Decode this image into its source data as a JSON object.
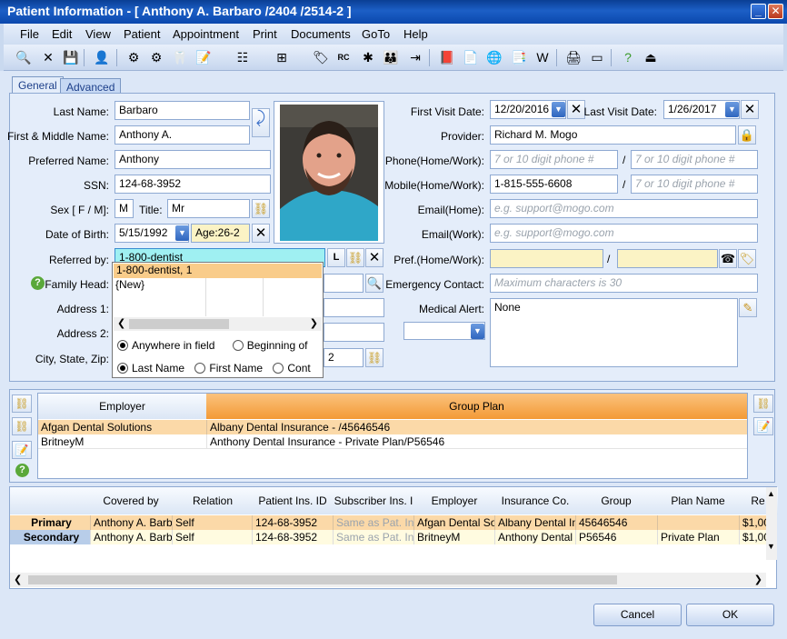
{
  "window": {
    "title": "Patient Information - [ Anthony A. Barbaro /2404 /2514-2 ]"
  },
  "menu": [
    "File",
    "Edit",
    "View",
    "Patient",
    "Appointment",
    "Print",
    "Documents",
    "GoTo",
    "Help"
  ],
  "tabs": [
    {
      "label": "General"
    },
    {
      "label": "Advanced"
    }
  ],
  "form": {
    "last_name_label": "Last Name:",
    "last_name": "Barbaro",
    "first_name_label": "First & Middle Name:",
    "first_name": "Anthony A.",
    "preferred_name_label": "Preferred Name:",
    "preferred_name": "Anthony",
    "ssn_label": "SSN:",
    "ssn": "124-68-3952",
    "sex_label": "Sex [ F / M]:",
    "sex": "M",
    "title_label": "Title:",
    "title": "Mr",
    "dob_label": "Date of Birth:",
    "dob": "5/15/1992",
    "age": "Age:26-2",
    "referred_label": "Referred by:",
    "referred_value": "1-800-dentist",
    "l_button": "L",
    "family_head_label": "Family Head:",
    "address1_label": "Address 1:",
    "address2_label": "Address 2:",
    "city_label": "City, State, Zip:",
    "city_partial": "2",
    "first_visit_label": "First Visit Date:",
    "first_visit": "12/20/2016",
    "last_visit_label": "Last Visit Date:",
    "last_visit": "1/26/2017",
    "provider_label": "Provider:",
    "provider": "Richard M. Mogo",
    "phone_label": "Phone(Home/Work):",
    "phone_ph": "7 or 10 digit phone #",
    "mobile_label": "Mobile(Home/Work):",
    "mobile": "1-815-555-6608",
    "email_home_label": "Email(Home):",
    "email_work_label": "Email(Work):",
    "email_ph": "e.g. support@mogo.com",
    "pref_label": "Pref.(Home/Work):",
    "emergency_label": "Emergency Contact:",
    "emergency_ph": "Maximum characters is 30",
    "medical_label": "Medical Alert:",
    "medical_value": "None",
    "slash": "/"
  },
  "popup": {
    "highlight": "1-800-dentist, 1",
    "new_item": "{New}",
    "match_opts": [
      "Anywhere in field",
      "Beginning of"
    ],
    "field_opts": [
      "Last Name",
      "First Name",
      "Cont"
    ]
  },
  "employer_grid": {
    "headers": [
      "Employer",
      "Group Plan"
    ],
    "rows": [
      [
        "Afgan Dental Solutions",
        "Albany Dental Insurance - /45646546"
      ],
      [
        "BritneyM",
        "Anthony Dental Insurance - Private Plan/P56546"
      ]
    ]
  },
  "insurance_grid": {
    "headers": [
      "Covered by",
      "Relation",
      "Patient Ins. ID",
      "Subscriber Ins. I",
      "Employer",
      "Insurance Co.",
      "Group",
      "Plan Name",
      "Re"
    ],
    "rows": [
      {
        "type": "Primary",
        "cells": [
          "Anthony A. Barb",
          "Self",
          "124-68-3952",
          "Same as Pat. In",
          "Afgan Dental So",
          "Albany Dental In",
          "45646546",
          "",
          "$1,00"
        ]
      },
      {
        "type": "Secondary",
        "cells": [
          "Anthony A. Barb",
          "Self",
          "124-68-3952",
          "Same as Pat. In",
          "BritneyM",
          "Anthony Dental I",
          "P56546",
          "Private Plan",
          "$1,00"
        ]
      }
    ]
  },
  "buttons": {
    "cancel": "Cancel",
    "ok": "OK"
  },
  "colors": {
    "accent_orange": "#f6a94c",
    "title_blue": "#1c5fc6"
  }
}
